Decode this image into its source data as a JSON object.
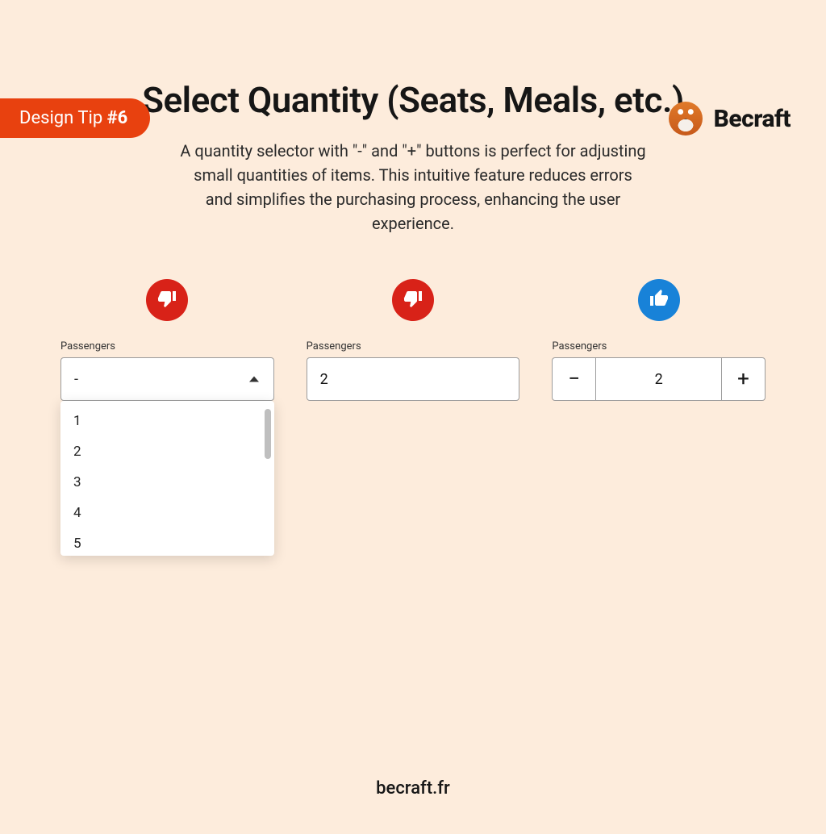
{
  "badge": {
    "prefix": "Design Tip ",
    "num": "#6"
  },
  "brand": {
    "name": "Becraft"
  },
  "title": "Select Quantity (Seats, Meals, etc.)",
  "description": "A quantity selector with \"-\" and \"+\" buttons is perfect for adjusting small quantities of items. This intuitive feature reduces errors and simplifies the purchasing process, enhancing the user experience.",
  "columns": {
    "dropdown": {
      "label": "Passengers",
      "value": "-",
      "options": [
        "1",
        "2",
        "3",
        "4",
        "5"
      ]
    },
    "textinput": {
      "label": "Passengers",
      "value": "2"
    },
    "stepper": {
      "label": "Passengers",
      "value": "2",
      "minus_glyph": "−",
      "plus_glyph": "+"
    }
  },
  "footer": "becraft.fr"
}
